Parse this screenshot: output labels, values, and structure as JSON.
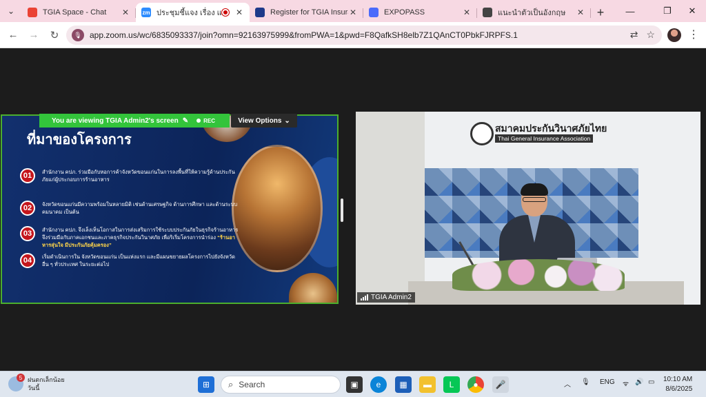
{
  "browser": {
    "tabs": [
      {
        "title": "TGIA Space - Chat",
        "favicon": "gmail-icon",
        "color": "#ea4335"
      },
      {
        "title": "ประชุมชี้แจง เรื่อง แนะนำ",
        "favicon": "zoom-icon",
        "color": "#2d8cff",
        "badge": "zm",
        "active": true
      },
      {
        "title": "Register for TGIA Insuran",
        "favicon": "tgia-icon",
        "color": "#1e3a8a"
      },
      {
        "title": "EXPOPASS",
        "favicon": "expopass-icon",
        "color": "#4b6bfb"
      },
      {
        "title": "แนะนำตัวเป็นอังกฤษ",
        "favicon": "chatgpt-icon",
        "color": "#444444"
      }
    ],
    "new_tab": "+",
    "url": "app.zoom.us/wc/6835093337/join?omn=92163975999&fromPWA=1&pwd=F8QafkSH8elb7Z1QAnCT0PbkFJRPFS.1"
  },
  "meeting": {
    "viewing_text": "You are viewing  TGIA Admin2's screen",
    "rec_label": "REC",
    "view_options_label": "View Options",
    "speaker_name": "TGIA Admin2"
  },
  "slide": {
    "title": "ที่มาของโครงการ",
    "items": [
      {
        "num": "01",
        "text": "สำนักงาน คปภ. ร่วมมือกับหอการค้าจังหวัดขอนแก่นในการลงพื้นที่ให้ความรู้ด้านประกันภัยแก่ผู้ประกอบการร้านอาหาร"
      },
      {
        "num": "02",
        "text": "จังหวัดขอนแก่นมีความพร้อมในหลายมิติ เช่นด้านเศรษฐกิจ ด้านการศึกษา และด้านระบบคมนาคม เป็นต้น"
      },
      {
        "num": "03",
        "text": "สำนักงาน คปภ. จึงเล็งเห็นโอกาสในการส่งเสริมการใช้ระบบประกันภัยในธุรกิจร้านอาหาร จึงร่วมมือกับภาคเอกชนและภาคธุรกิจประกันวินาศภัย เพื่อริเริ่มโครงการนำร่อง",
        "highlight": "“ร้านอาหารสุ่นใจ มีประกันภัยคุ้มครอง”"
      },
      {
        "num": "04",
        "text": "เริ่มดำเนินการใน จังหวัดขอนแก่น เป็นแห่งแรก และมีแผนขยายผลโครงการไปยังจังหวัดอื่น ๆ ทั่วประเทศ ในระยะต่อไป"
      }
    ]
  },
  "video": {
    "org_name_th": "สมาคมประกันวินาศภัยไทย",
    "org_name_en": "Thai General Insurance Association"
  },
  "taskbar": {
    "weather_badge": "5",
    "weather_line1": "ฝนตกเล็กน้อย",
    "weather_line2": "วันนี้",
    "search_placeholder": "Search",
    "language": "ENG",
    "time": "10:10 AM",
    "date": "8/6/2025"
  }
}
